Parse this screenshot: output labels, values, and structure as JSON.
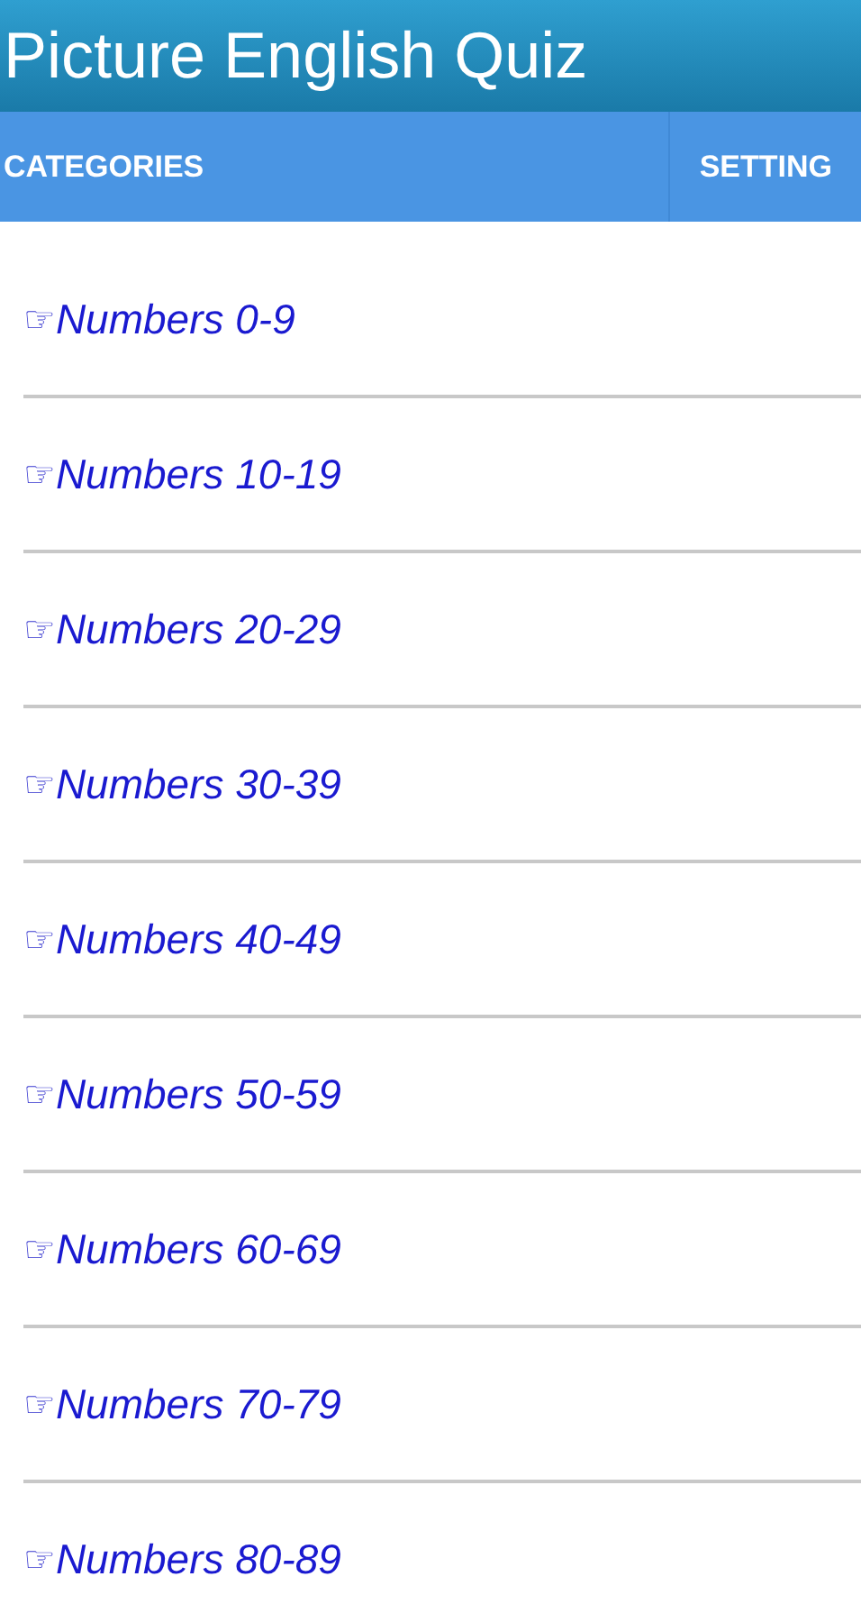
{
  "app_bar": {
    "title": "Picture English Quiz"
  },
  "tabs": [
    {
      "label": "CATEGORIES"
    },
    {
      "label": "SETTING"
    }
  ],
  "categories": [
    {
      "icon": "☞",
      "label": "Numbers 0-9"
    },
    {
      "icon": "☞",
      "label": "Numbers 10-19"
    },
    {
      "icon": "☞",
      "label": "Numbers 20-29"
    },
    {
      "icon": "☞",
      "label": "Numbers 30-39"
    },
    {
      "icon": "☞",
      "label": "Numbers 40-49"
    },
    {
      "icon": "☞",
      "label": "Numbers 50-59"
    },
    {
      "icon": "☞",
      "label": "Numbers 60-69"
    },
    {
      "icon": "☞",
      "label": "Numbers 70-79"
    },
    {
      "icon": "☞",
      "label": "Numbers 80-89"
    }
  ]
}
